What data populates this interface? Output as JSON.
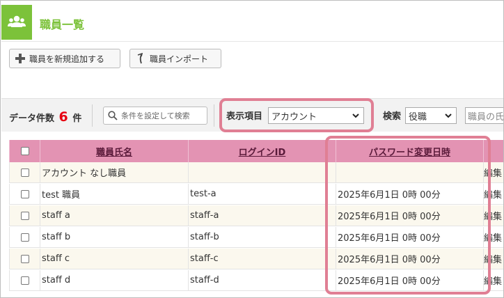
{
  "page": {
    "title": "職員一覧",
    "colors": {
      "brand": "#7cc23a",
      "accent": "#e60012",
      "table_header": "#e393b3",
      "highlight": "#e07f94"
    }
  },
  "toolbar": {
    "add_label": "職員を新規追加する",
    "import_label": "職員インポート"
  },
  "filter": {
    "count_label": "データ件数",
    "count": "6",
    "count_suffix": "件",
    "condition_button": "条件を設定して検索",
    "display_label": "表示項目",
    "display_value": "アカウント",
    "search_label": "検索",
    "role_value": "役職",
    "name_placeholder": "職員の氏名"
  },
  "table": {
    "headers": {
      "name": "職員氏名",
      "login": "ログインID",
      "password_changed": "パスワード変更日時",
      "edit": ""
    },
    "rows": [
      {
        "name": "アカウント なし職員",
        "login": "",
        "password_changed": "",
        "edit": "編集"
      },
      {
        "name": "test 職員",
        "login": "test-a",
        "password_changed": "2025年6月1日 0時 00分",
        "edit": "編集"
      },
      {
        "name": "staff a",
        "login": "staff-a",
        "password_changed": "2025年6月1日 0時 00分",
        "edit": "編集"
      },
      {
        "name": "staff b",
        "login": "staff-b",
        "password_changed": "2025年6月1日 0時 00分",
        "edit": "編集"
      },
      {
        "name": "staff c",
        "login": "staff-c",
        "password_changed": "2025年6月1日 0時 00分",
        "edit": "編集"
      },
      {
        "name": "staff d",
        "login": "staff-d",
        "password_changed": "2025年6月1日 0時 00分",
        "edit": "編集"
      }
    ]
  }
}
